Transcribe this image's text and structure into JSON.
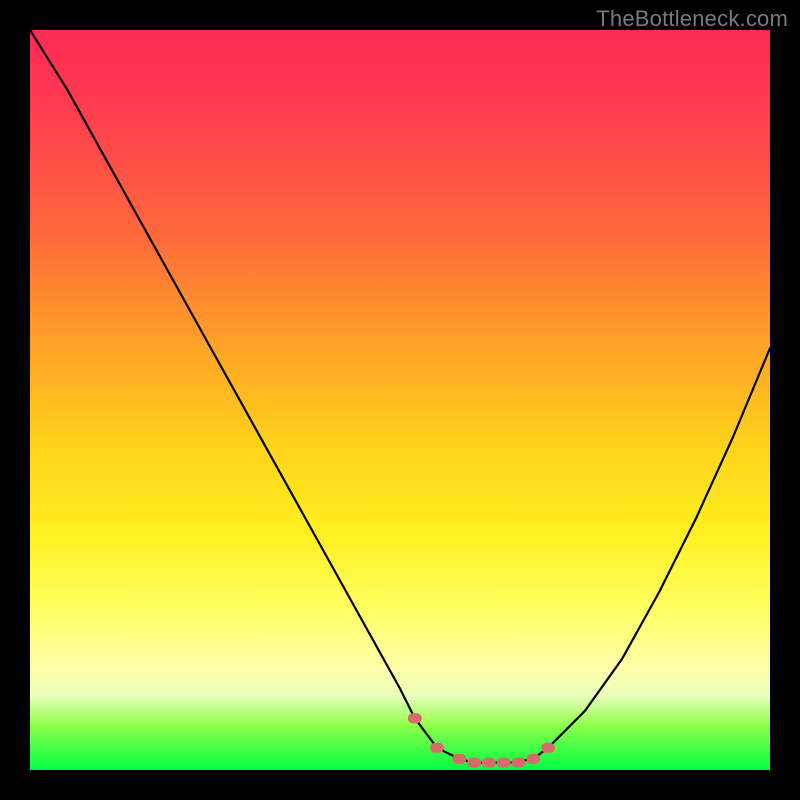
{
  "watermark": "TheBottleneck.com",
  "colors": {
    "background": "#000000",
    "curve": "#000000",
    "marker": "#d86a6a",
    "gradient_stops": [
      "#ff2a55",
      "#ff3a50",
      "#ff6a3a",
      "#ffa028",
      "#ffd21a",
      "#fff020",
      "#ffff60",
      "#feffa8",
      "#e9ffb8",
      "#8dff4a",
      "#00ff44"
    ]
  },
  "chart_data": {
    "type": "line",
    "title": "",
    "xlabel": "",
    "ylabel": "",
    "xlim": [
      0,
      100
    ],
    "ylim": [
      0,
      100
    ],
    "grid": false,
    "x": [
      0,
      5,
      10,
      15,
      20,
      25,
      30,
      35,
      40,
      45,
      50,
      52,
      55,
      58,
      60,
      62,
      65,
      68,
      70,
      75,
      80,
      85,
      90,
      95,
      100
    ],
    "values": [
      100,
      92,
      83,
      74,
      65,
      56,
      47,
      38,
      29,
      20,
      11,
      7,
      3,
      1.5,
      1,
      1,
      1,
      1.5,
      3,
      8,
      15,
      24,
      34,
      45,
      57
    ],
    "markers": {
      "comment": "pink/coral dotted markers near the valley floor",
      "x": [
        52,
        55,
        58,
        60,
        62,
        64,
        66,
        68,
        70
      ],
      "values": [
        7,
        3,
        1.5,
        1,
        1,
        1,
        1,
        1.5,
        3
      ]
    }
  }
}
